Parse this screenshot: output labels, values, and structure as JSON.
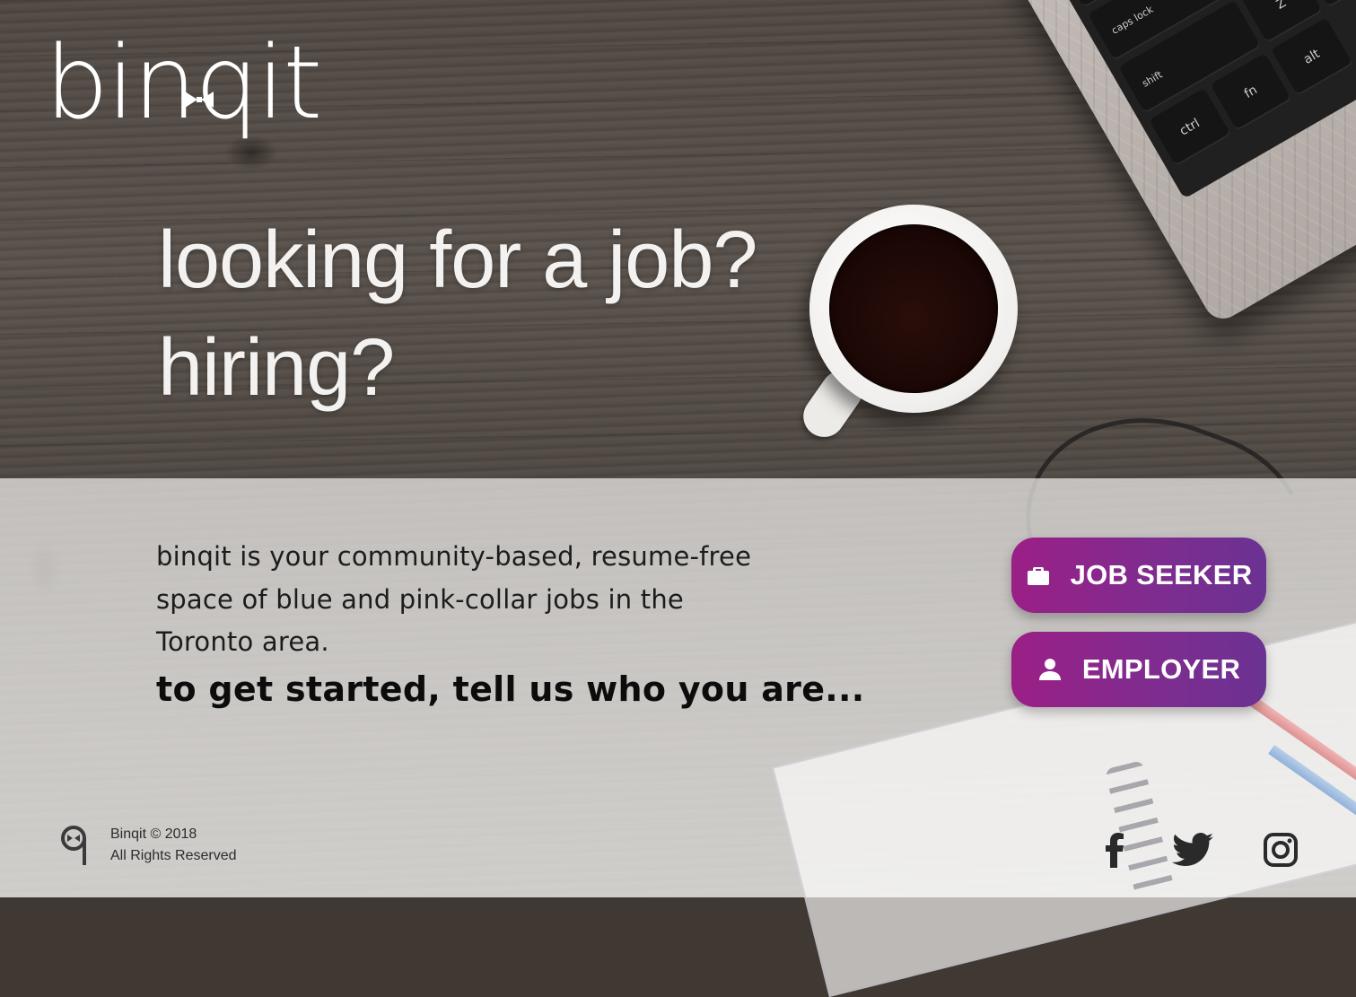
{
  "brand": {
    "logo_text": "binqit"
  },
  "hero": {
    "headline_1": "looking for a job?",
    "headline_2": "hiring?"
  },
  "intro": {
    "description": "binqit is your community-based, resume-free space of blue and pink-collar jobs in the Toronto area.",
    "call_to_action": "to get started, tell us who you are..."
  },
  "buttons": {
    "job_seeker": {
      "label": "JOB SEEKER",
      "icon": "briefcase-icon"
    },
    "employer": {
      "label": "EMPLOYER",
      "icon": "person-icon"
    }
  },
  "footer": {
    "copyright_line1": "Binqit © 2018",
    "copyright_line2": "All Rights Reserved",
    "social": [
      "facebook-icon",
      "twitter-icon",
      "instagram-icon"
    ]
  },
  "colors": {
    "button_gradient_start": "#9b1f86",
    "button_gradient_end": "#6b3292",
    "headline": "#f4f2f0"
  }
}
